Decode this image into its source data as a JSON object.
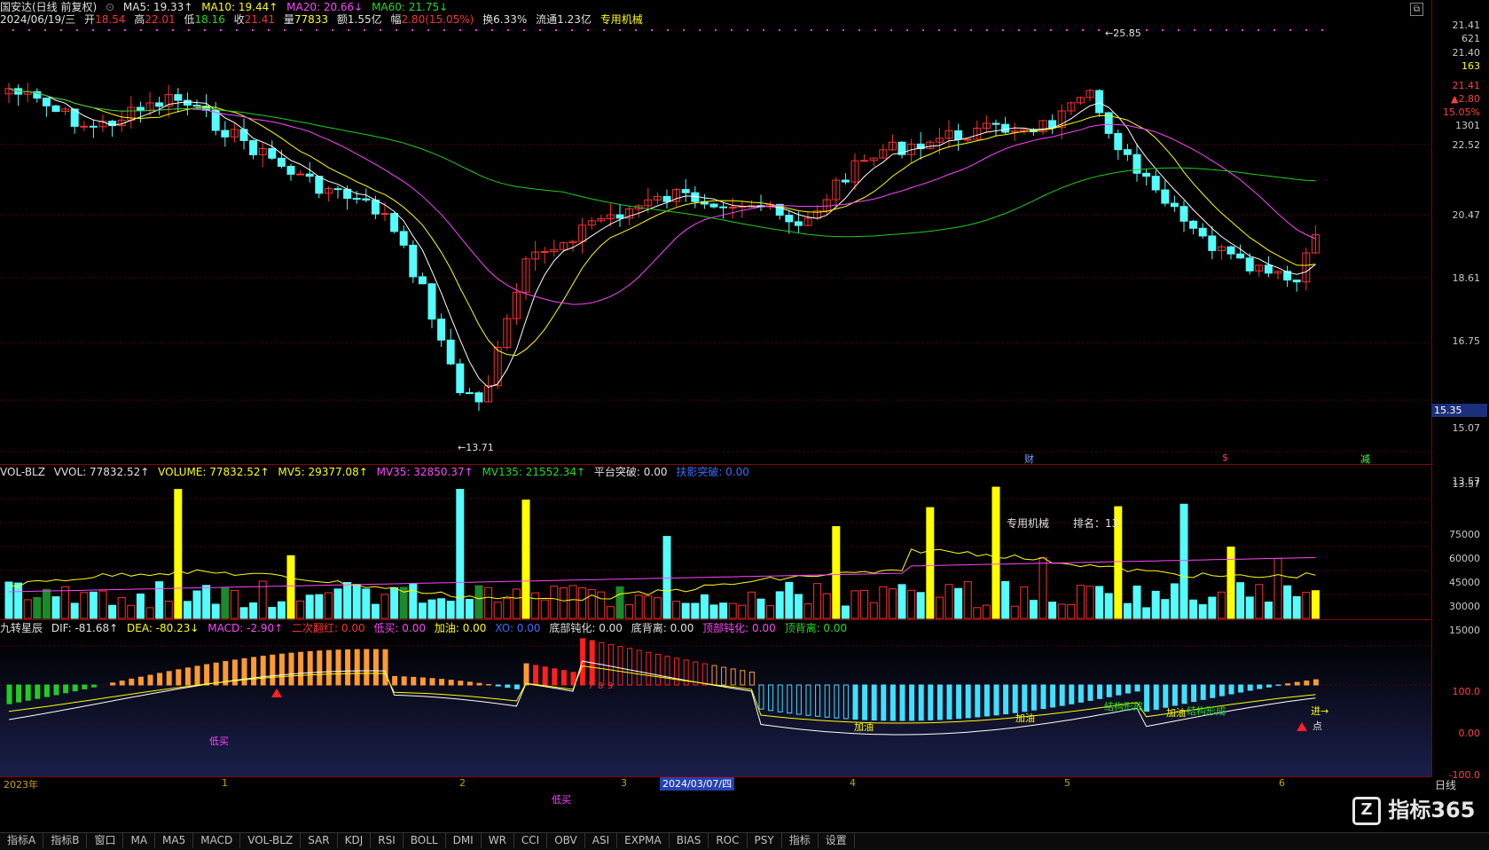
{
  "stock": {
    "title": "国安达(日线 前复权)",
    "date_line": "2024/06/19/三",
    "open_label": "开",
    "open": "18.54",
    "high_label": "高",
    "high": "22.01",
    "low_label": "低",
    "low": "18.16",
    "close_label": "收",
    "close": "21.41",
    "vol_label": "量",
    "vol": "77833",
    "amount_label": "额",
    "amount": "1.55亿",
    "change_label": "幅",
    "change": "2.80(15.05%)",
    "turnover_label": "换",
    "turnover": "6.33%",
    "float_label": "流通",
    "float_cap": "1.23亿",
    "sector": "专用机械"
  },
  "ma": {
    "ma5": "MA5: 19.33↑",
    "ma10": "MA10: 19.44↑",
    "ma20": "MA20: 20.66↓",
    "ma60": "MA60: 21.75↓"
  },
  "colors": {
    "up": "#ff3030",
    "down": "#54fcfc",
    "ma5": "#ffffff",
    "ma10": "#ffff00",
    "ma20": "#ff44ff",
    "ma60": "#22cc22",
    "axis_red": "#8a0000"
  },
  "price_pane": {
    "high_annot": "25.85",
    "low_annot": "13.71",
    "current_price_tag": "15.35",
    "ticks": [
      "22.52",
      "20.47",
      "18.61",
      "16.75",
      "15.07",
      "13.57"
    ],
    "side_info": [
      "21.41",
      "621",
      "21.40",
      "163",
      "21.41",
      "▲2.80",
      "15.05%",
      "1301"
    ],
    "markers": [
      "财",
      "$",
      "减"
    ]
  },
  "volume_pane": {
    "name": "VOL-BLZ",
    "vvol": "VVOL: 77832.52↑",
    "volume": "VOLUME: 77832.52↑",
    "mv5": "MV5: 29377.08↑",
    "mv35": "MV35: 32850.37↑",
    "mv135": "MV135: 21552.34↑",
    "platform": "平台突破: 0.00",
    "break": "扶影突破: 0.00",
    "sector_label": "专用机械",
    "rank_label": "排名：13",
    "ticks": [
      "75000",
      "60000",
      "45000",
      "30000",
      "15000"
    ]
  },
  "macd_pane": {
    "name": "九转星辰",
    "dif": "DIF: -81.68↑",
    "dea": "DEA: -80.23↓",
    "macd": "MACD: -2.90↑",
    "red2": "二次翻红: 0.00",
    "low_buy": "低买: 0.00",
    "add": "加油: 0.00",
    "xo": "XO: 0.00",
    "bottom_dull": "底部钝化: 0.00",
    "bottom_div": "底背离: 0.00",
    "top_dull": "顶部钝化: 0.00",
    "top_div": "顶背离: 0.00",
    "ticks": [
      "100.0",
      "0.00",
      "-100.0"
    ],
    "annotations": {
      "lowbuy1": "低买",
      "lowbuy2": "低买",
      "jiayou1": "加油",
      "jiayou2": "加油",
      "jiegou1": "结构形成",
      "jiegou2": "结构形成",
      "jiayou3": "加油",
      "jin": "进→",
      "dian": "点",
      "nine": [
        "7",
        "8",
        "9"
      ]
    }
  },
  "date_axis": {
    "year": "2023年",
    "months": [
      "1",
      "2",
      "3",
      "4",
      "5",
      "6"
    ],
    "cursor_date": "2024/03/07/四",
    "period": "日线"
  },
  "bottom_tabs": [
    "指标A",
    "指标B",
    "窗口",
    "MA",
    "MA5",
    "MACD",
    "VOL-BLZ",
    "SAR",
    "KDJ",
    "RSI",
    "BOLL",
    "DMI",
    "WR",
    "CCI",
    "OBV",
    "ASI",
    "EXPMA",
    "BIAS",
    "ROC",
    "PSY",
    "指标",
    "设置"
  ],
  "watermark": "指标365"
}
